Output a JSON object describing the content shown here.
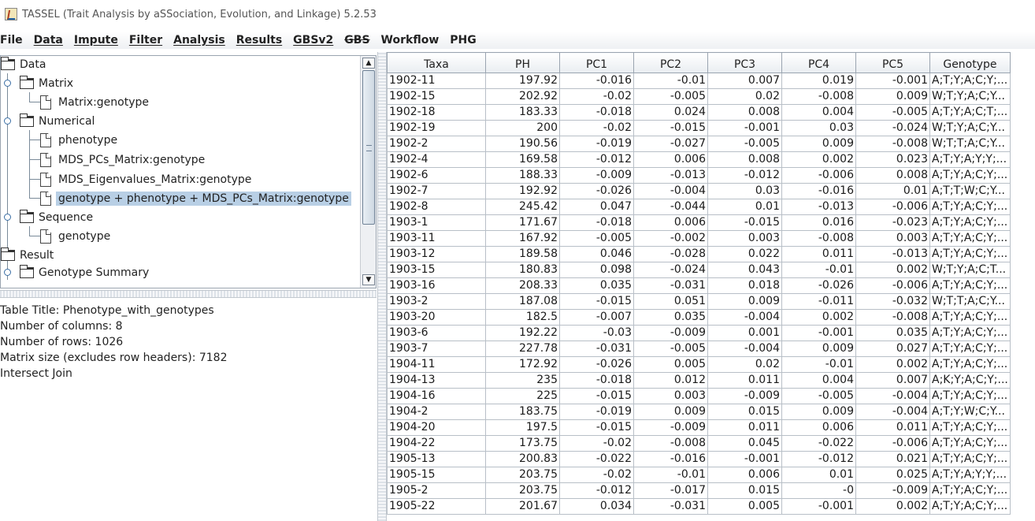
{
  "window": {
    "title": "TASSEL (Trait Analysis by aSSociation, Evolution, and Linkage) 5.2.53"
  },
  "menu": [
    {
      "label": "File",
      "underline": false,
      "strike": false
    },
    {
      "label": "Data",
      "underline": true,
      "strike": false
    },
    {
      "label": "Impute",
      "underline": true,
      "strike": false
    },
    {
      "label": "Filter",
      "underline": true,
      "strike": false
    },
    {
      "label": "Analysis",
      "underline": true,
      "strike": false
    },
    {
      "label": "Results",
      "underline": true,
      "strike": false
    },
    {
      "label": "GBSv2",
      "underline": true,
      "strike": false
    },
    {
      "label": "GBS",
      "underline": false,
      "strike": true
    },
    {
      "label": "Workflow",
      "underline": false,
      "strike": false
    },
    {
      "label": "PHG",
      "underline": false,
      "strike": false
    }
  ],
  "tree": {
    "data": "Data",
    "matrix": "Matrix",
    "matrix_genotype": "Matrix:genotype",
    "numerical": "Numerical",
    "phenotype": "phenotype",
    "mds_pcs": "MDS_PCs_Matrix:genotype",
    "mds_eigen": "MDS_Eigenvalues_Matrix:genotype",
    "joined": "genotype + phenotype + MDS_PCs_Matrix:genotype",
    "sequence": "Sequence",
    "seq_genotype": "genotype",
    "result": "Result",
    "genotype_summary": "Genotype Summary"
  },
  "info": {
    "title": "Table Title: Phenotype_with_genotypes",
    "columns": "Number of columns: 8",
    "rows": "Number of rows: 1026",
    "matrix_size": "Matrix size (excludes row headers): 7182",
    "join": "Intersect Join"
  },
  "table": {
    "headers": [
      "Taxa",
      "PH",
      "PC1",
      "PC2",
      "PC3",
      "PC4",
      "PC5",
      "Genotype"
    ],
    "rows": [
      [
        "1902-11",
        "197.92",
        "-0.016",
        "-0.01",
        "0.007",
        "0.019",
        "-0.001",
        "A;T;Y;A;C;Y;..."
      ],
      [
        "1902-15",
        "202.92",
        "-0.02",
        "-0.005",
        "0.02",
        "-0.008",
        "0.009",
        "W;T;Y;A;C;Y..."
      ],
      [
        "1902-18",
        "183.33",
        "-0.018",
        "0.024",
        "0.008",
        "0.004",
        "-0.005",
        "A;T;Y;A;C;T;..."
      ],
      [
        "1902-19",
        "200",
        "-0.02",
        "-0.015",
        "-0.001",
        "0.03",
        "-0.024",
        "W;T;Y;A;C;Y..."
      ],
      [
        "1902-2",
        "190.56",
        "-0.019",
        "-0.027",
        "-0.005",
        "0.009",
        "-0.008",
        "W;T;T;A;C;Y..."
      ],
      [
        "1902-4",
        "169.58",
        "-0.012",
        "0.006",
        "0.008",
        "0.002",
        "0.023",
        "A;T;Y;A;Y;Y;..."
      ],
      [
        "1902-6",
        "188.33",
        "-0.009",
        "-0.013",
        "-0.012",
        "-0.006",
        "0.008",
        "A;T;Y;A;C;Y;..."
      ],
      [
        "1902-7",
        "192.92",
        "-0.026",
        "-0.004",
        "0.03",
        "-0.016",
        "0.01",
        "A;T;T;W;C;Y..."
      ],
      [
        "1902-8",
        "245.42",
        "0.047",
        "-0.044",
        "0.01",
        "-0.013",
        "-0.006",
        "A;T;Y;A;C;Y;..."
      ],
      [
        "1903-1",
        "171.67",
        "-0.018",
        "0.006",
        "-0.015",
        "0.016",
        "-0.023",
        "A;T;Y;A;C;Y;..."
      ],
      [
        "1903-11",
        "167.92",
        "-0.005",
        "-0.002",
        "0.003",
        "-0.008",
        "0.003",
        "A;T;Y;A;C;Y;..."
      ],
      [
        "1903-12",
        "189.58",
        "0.046",
        "-0.028",
        "0.022",
        "0.011",
        "-0.013",
        "A;T;Y;A;C;Y;..."
      ],
      [
        "1903-15",
        "180.83",
        "0.098",
        "-0.024",
        "0.043",
        "-0.01",
        "0.002",
        "W;T;Y;A;C;T..."
      ],
      [
        "1903-16",
        "208.33",
        "0.035",
        "-0.031",
        "0.018",
        "-0.026",
        "-0.006",
        "A;T;Y;A;C;Y;..."
      ],
      [
        "1903-2",
        "187.08",
        "-0.015",
        "0.051",
        "0.009",
        "-0.011",
        "-0.032",
        "W;T;T;A;C;Y..."
      ],
      [
        "1903-20",
        "182.5",
        "-0.007",
        "0.035",
        "-0.004",
        "0.002",
        "-0.008",
        "A;T;Y;A;C;Y;..."
      ],
      [
        "1903-6",
        "192.22",
        "-0.03",
        "-0.009",
        "0.001",
        "-0.001",
        "0.035",
        "A;T;Y;A;C;Y;..."
      ],
      [
        "1903-7",
        "227.78",
        "-0.031",
        "-0.005",
        "-0.004",
        "0.009",
        "0.027",
        "A;T;Y;A;C;Y;..."
      ],
      [
        "1904-11",
        "172.92",
        "-0.026",
        "0.005",
        "0.02",
        "-0.01",
        "0.002",
        "A;T;Y;A;C;Y;..."
      ],
      [
        "1904-13",
        "235",
        "-0.018",
        "0.012",
        "0.011",
        "0.004",
        "0.007",
        "A;K;Y;A;C;Y;..."
      ],
      [
        "1904-16",
        "225",
        "-0.015",
        "0.003",
        "-0.009",
        "-0.005",
        "-0.004",
        "A;T;Y;A;C;Y;..."
      ],
      [
        "1904-2",
        "183.75",
        "-0.019",
        "0.009",
        "0.015",
        "0.009",
        "-0.004",
        "A;T;Y;W;C;Y..."
      ],
      [
        "1904-20",
        "197.5",
        "-0.015",
        "-0.009",
        "0.011",
        "0.006",
        "0.011",
        "A;T;Y;A;C;Y;..."
      ],
      [
        "1904-22",
        "173.75",
        "-0.02",
        "-0.008",
        "0.045",
        "-0.022",
        "-0.006",
        "A;T;Y;A;C;Y;..."
      ],
      [
        "1905-13",
        "200.83",
        "-0.022",
        "-0.016",
        "-0.001",
        "-0.012",
        "0.021",
        "A;T;Y;A;C;Y;..."
      ],
      [
        "1905-15",
        "203.75",
        "-0.02",
        "-0.01",
        "0.006",
        "0.01",
        "0.025",
        "A;T;Y;A;Y;Y;..."
      ],
      [
        "1905-2",
        "203.75",
        "-0.012",
        "-0.017",
        "0.015",
        "-0",
        "-0.009",
        "A;T;Y;A;C;Y;..."
      ],
      [
        "1905-22",
        "201.67",
        "0.034",
        "-0.031",
        "0.005",
        "-0.001",
        "0.002",
        "A;T;Y;A;C;Y;..."
      ]
    ]
  }
}
